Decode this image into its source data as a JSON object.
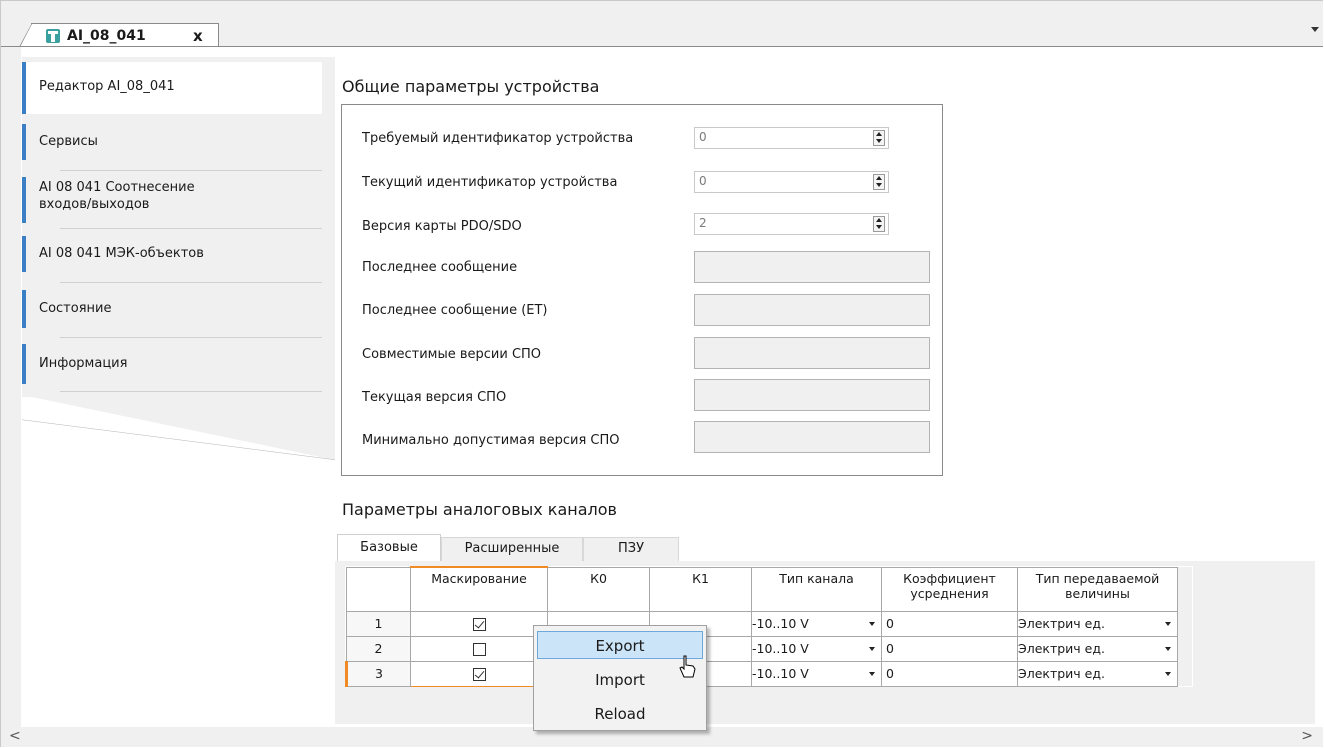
{
  "document_tab": {
    "title": "AI_08_041",
    "close_symbol": "x"
  },
  "side_nav": {
    "items": [
      {
        "label": "Редактор AI_08_041"
      },
      {
        "label": "Сервисы"
      },
      {
        "label": "AI 08 041 Соотнесение входов/выходов"
      },
      {
        "label": "AI 08 041 МЭК-объектов"
      },
      {
        "label": "Состояние"
      },
      {
        "label": "Информация"
      }
    ]
  },
  "general_params": {
    "title": "Общие параметры устройства",
    "rows": [
      {
        "label": "Требуемый идентификатор устройства",
        "value": "0"
      },
      {
        "label": "Текущий идентификатор устройства",
        "value": "0"
      },
      {
        "label": "Версия карты PDO/SDO",
        "value": "2"
      },
      {
        "label": "Последнее сообщение",
        "value": ""
      },
      {
        "label": "Последнее сообщение (ET)",
        "value": ""
      },
      {
        "label": "Совместимые версии СПО",
        "value": ""
      },
      {
        "label": "Текущая версия СПО",
        "value": ""
      },
      {
        "label": "Минимально допустимая версия СПО",
        "value": ""
      }
    ]
  },
  "analog_channels": {
    "title": "Параметры аналоговых каналов",
    "tabs": [
      {
        "label": "Базовые"
      },
      {
        "label": "Расширенные"
      },
      {
        "label": "ПЗУ"
      }
    ],
    "columns": [
      "",
      "Маскирование",
      "К0",
      "К1",
      "Тип канала",
      "Коэффициент усреднения",
      "Тип передаваемой величины"
    ],
    "rows": [
      {
        "num": "1",
        "masked": true,
        "k0": "",
        "k1": "",
        "channel_type": "-10..10 V",
        "averaging": "0",
        "value_type": "Электрич ед."
      },
      {
        "num": "2",
        "masked": false,
        "k0": "",
        "k1": "",
        "channel_type": "-10..10 V",
        "averaging": "0",
        "value_type": "Электрич ед."
      },
      {
        "num": "3",
        "masked": true,
        "k0": "",
        "k1": "",
        "channel_type": "-10..10 V",
        "averaging": "0",
        "value_type": "Электрич ед."
      }
    ]
  },
  "context_menu": {
    "items": [
      {
        "label": "Export",
        "highlighted": true
      },
      {
        "label": "Import",
        "highlighted": false
      },
      {
        "label": "Reload",
        "highlighted": false
      }
    ]
  },
  "scrollbar": {
    "left": "<",
    "right": ">"
  },
  "colors": {
    "accent": "#3c7fc4",
    "highlight": "#cce4f7",
    "row_marker": "#f08a24"
  },
  "icons": [
    "device-icon",
    "close-icon",
    "dropdown-arrow-icon",
    "spin-updown-icon",
    "checkbox-icon",
    "mouse-cursor-icon"
  ]
}
